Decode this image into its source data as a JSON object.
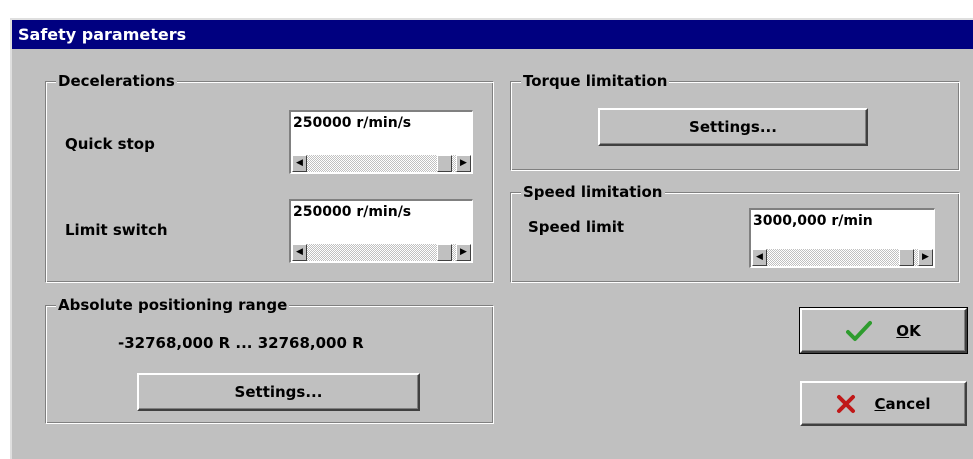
{
  "window": {
    "title": "Safety parameters"
  },
  "decelerations": {
    "legend": "Decelerations",
    "quick_stop": {
      "label": "Quick stop",
      "value": "250000  r/min/s"
    },
    "limit_switch": {
      "label": "Limit switch",
      "value": "250000  r/min/s"
    }
  },
  "torque": {
    "legend": "Torque limitation",
    "settings_label": "Settings..."
  },
  "speed": {
    "legend": "Speed limitation",
    "limit_label": "Speed limit",
    "limit_value": "3000,000  r/min"
  },
  "absolute": {
    "legend": "Absolute positioning range",
    "range_text": "-32768,000  R ... 32768,000  R",
    "settings_label": "Settings..."
  },
  "buttons": {
    "ok": {
      "mnemonic": "O",
      "rest": "K",
      "icon": "check-icon",
      "icon_color": "#2e9c2e"
    },
    "cancel": {
      "mnemonic": "C",
      "rest": "ancel",
      "icon": "x-icon",
      "icon_color": "#c01818"
    }
  }
}
